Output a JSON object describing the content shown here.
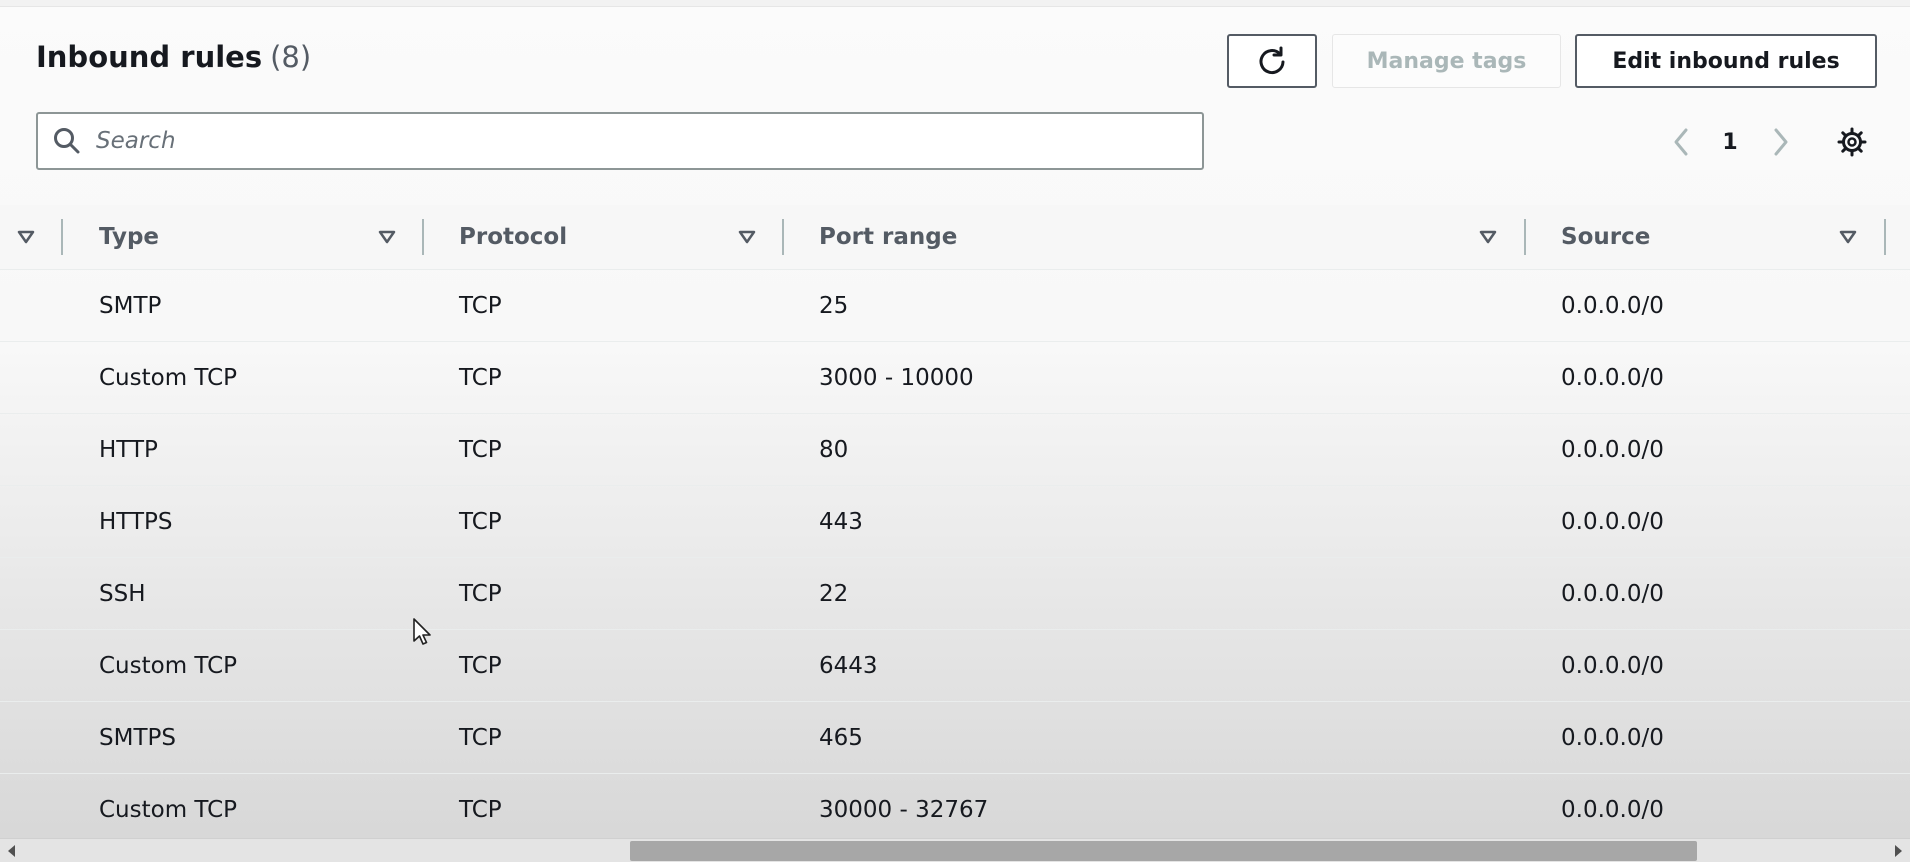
{
  "header": {
    "title": "Inbound rules",
    "count": "(8)"
  },
  "toolbar": {
    "refresh_icon": "refresh-icon",
    "manage_tags_label": "Manage tags",
    "edit_rules_label": "Edit inbound rules"
  },
  "search": {
    "placeholder": "Search",
    "value": ""
  },
  "pagination": {
    "current_page": "1"
  },
  "table": {
    "columns": [
      "Type",
      "Protocol",
      "Port range",
      "Source"
    ],
    "rows": [
      {
        "type": "SMTP",
        "protocol": "TCP",
        "port_range": "25",
        "source": "0.0.0.0/0"
      },
      {
        "type": "Custom TCP",
        "protocol": "TCP",
        "port_range": "3000 - 10000",
        "source": "0.0.0.0/0"
      },
      {
        "type": "HTTP",
        "protocol": "TCP",
        "port_range": "80",
        "source": "0.0.0.0/0"
      },
      {
        "type": "HTTPS",
        "protocol": "TCP",
        "port_range": "443",
        "source": "0.0.0.0/0"
      },
      {
        "type": "SSH",
        "protocol": "TCP",
        "port_range": "22",
        "source": "0.0.0.0/0"
      },
      {
        "type": "Custom TCP",
        "protocol": "TCP",
        "port_range": "6443",
        "source": "0.0.0.0/0"
      },
      {
        "type": "SMTPS",
        "protocol": "TCP",
        "port_range": "465",
        "source": "0.0.0.0/0"
      },
      {
        "type": "Custom TCP",
        "protocol": "TCP",
        "port_range": "30000 - 32767",
        "source": "0.0.0.0/0"
      }
    ]
  },
  "colors": {
    "text": "#16191f",
    "muted": "#545b64",
    "disabled": "#aab7b8",
    "border": "#8d9696"
  }
}
